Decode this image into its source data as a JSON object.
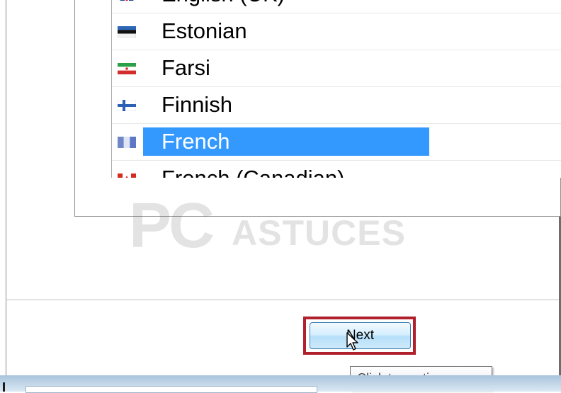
{
  "language_list": {
    "items": [
      {
        "label": "English (UK)",
        "flag": "uk-flag-icon",
        "selected": false
      },
      {
        "label": "Estonian",
        "flag": "estonia-flag-icon",
        "selected": false
      },
      {
        "label": "Farsi",
        "flag": "iran-flag-icon",
        "selected": false
      },
      {
        "label": "Finnish",
        "flag": "finland-flag-icon",
        "selected": false
      },
      {
        "label": "French",
        "flag": "france-flag-icon",
        "selected": true
      },
      {
        "label": "French (Canadian)",
        "flag": "canada-flag-icon",
        "selected": false
      }
    ],
    "selected_color": "#3399ff"
  },
  "watermark": {
    "pc": "PC",
    "astuces": "ASTUCES"
  },
  "footer": {
    "next_label": "Next",
    "tooltip": "Click to continue",
    "highlight_color": "#b0202d"
  }
}
